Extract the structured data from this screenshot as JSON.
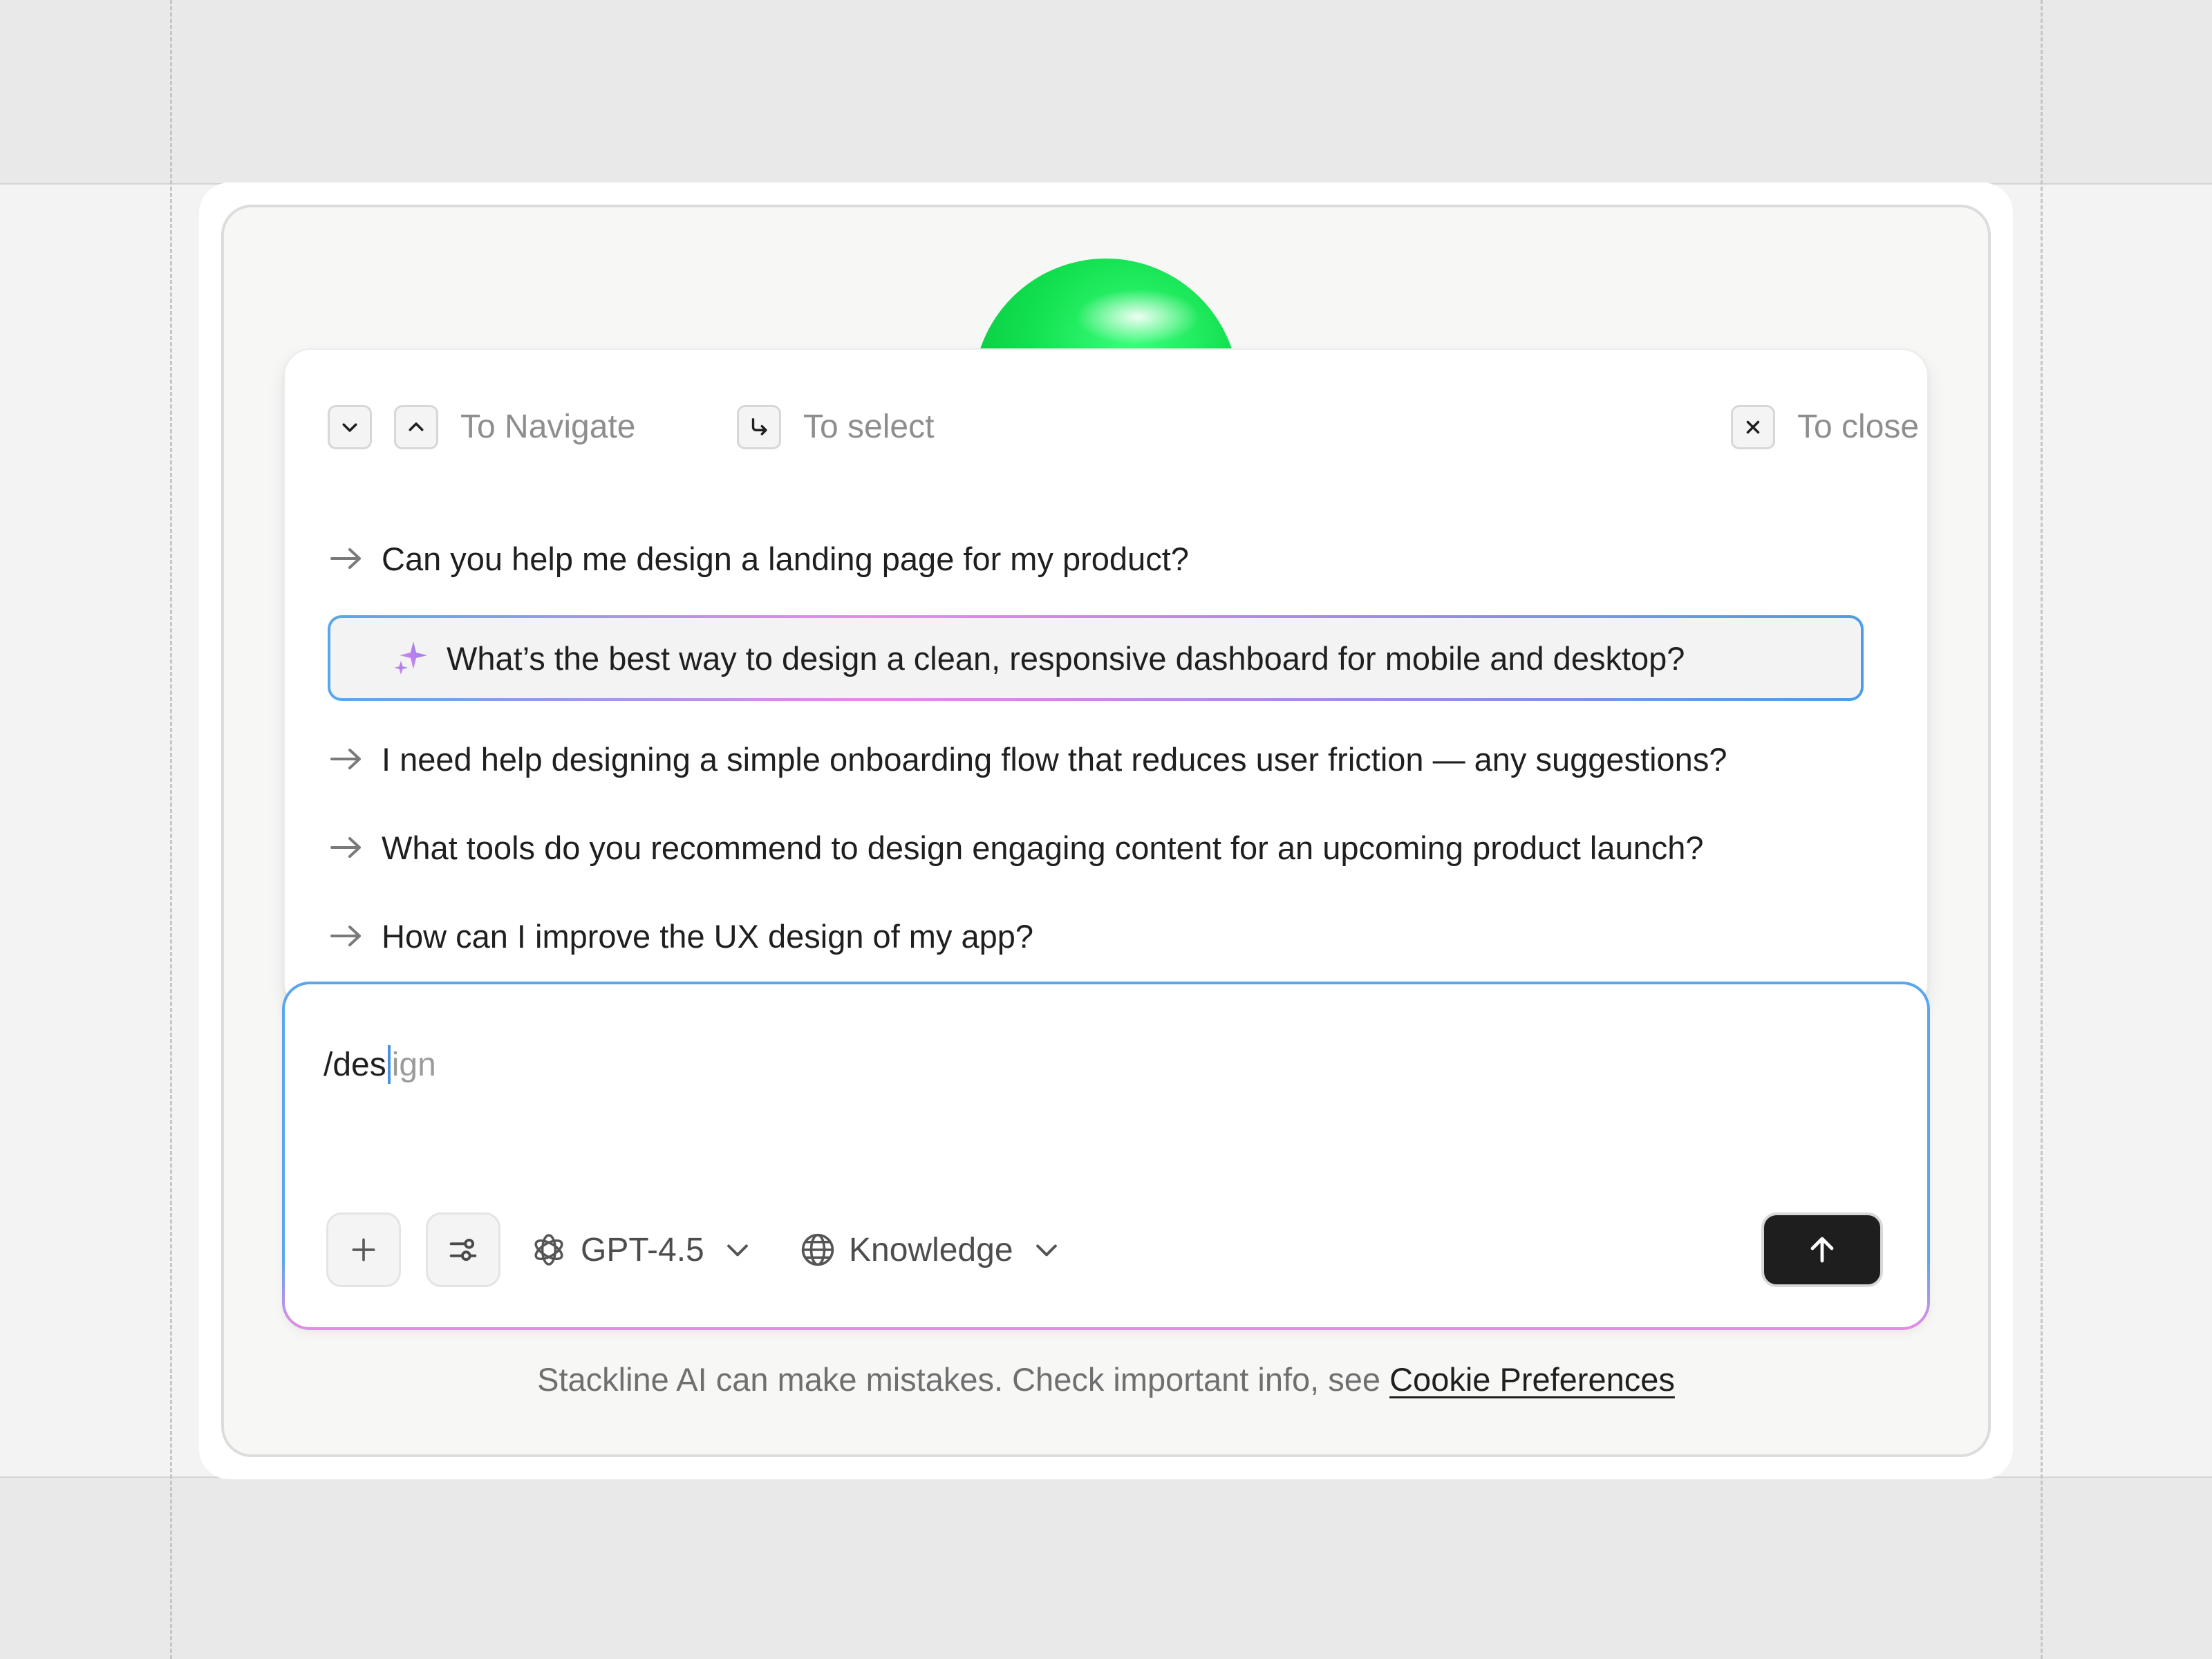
{
  "hints": {
    "navigate": "To Navigate",
    "select": "To select",
    "close": "To close",
    "icons": [
      "chevron-down-icon",
      "chevron-up-icon",
      "enter-icon",
      "close-icon"
    ]
  },
  "suggestions": [
    {
      "text": "Can you help me design a landing page for my product?",
      "active": false
    },
    {
      "text": "What’s the best way to design a clean, responsive dashboard for mobile and desktop?",
      "active": true
    },
    {
      "text": "I need help designing a simple onboarding flow that reduces user friction — any suggestions?",
      "active": false
    },
    {
      "text": "What tools do you recommend to design engaging content for an upcoming product launch?",
      "active": false
    },
    {
      "text": "How can I improve the UX design of my app?",
      "active": false
    }
  ],
  "composer": {
    "typed": "/des",
    "autocomplete": "ign",
    "model": "GPT-4.5",
    "source": "Knowledge"
  },
  "footer": {
    "disclaimer": "Stackline AI can make mistakes. Check important info, see",
    "link": "Cookie Preferences"
  },
  "colors": {
    "accent_blue": "#5aa6ee",
    "accent_pink": "#e88be2",
    "orb_green": "#11e04f",
    "send_button": "#1e1e1e"
  }
}
